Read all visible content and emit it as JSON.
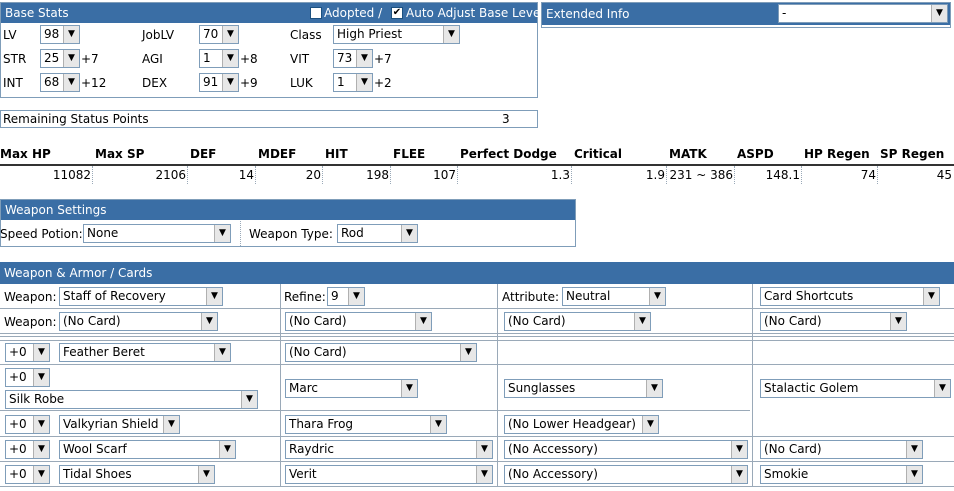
{
  "base_stats": {
    "title": "Base Stats",
    "adopted_label": "Adopted /",
    "adopted_checked": false,
    "auto_adjust_label": "Auto Adjust Base Level",
    "auto_adjust_checked": true,
    "lv_label": "LV",
    "lv": "98",
    "joblv_label": "JobLV",
    "joblv": "70",
    "class_label": "Class",
    "class": "High Priest",
    "str_label": "STR",
    "str": "25",
    "str_bonus": "+7",
    "agi_label": "AGI",
    "agi": "1",
    "agi_bonus": "+8",
    "vit_label": "VIT",
    "vit": "73",
    "vit_bonus": "+7",
    "int_label": "INT",
    "int": "68",
    "int_bonus": "+12",
    "dex_label": "DEX",
    "dex": "91",
    "dex_bonus": "+9",
    "luk_label": "LUK",
    "luk": "1",
    "luk_bonus": "+2"
  },
  "extended_info": {
    "title": "Extended Info",
    "value": "-"
  },
  "remaining": {
    "label": "Remaining Status Points",
    "value": "3"
  },
  "stats_table": {
    "headers": [
      "Max HP",
      "Max SP",
      "DEF",
      "MDEF",
      "HIT",
      "FLEE",
      "Perfect Dodge",
      "Critical",
      "MATK",
      "ASPD",
      "HP Regen",
      "SP Regen"
    ],
    "values": [
      "11082",
      "2106",
      "14",
      "20",
      "198",
      "107",
      "1.3",
      "1.9",
      "231 ~ 386",
      "148.1",
      "74",
      "45"
    ]
  },
  "weapon_settings": {
    "title": "Weapon Settings",
    "speed_potion_label": "Speed Potion:",
    "speed_potion": "None",
    "weapon_type_label": "Weapon Type:",
    "weapon_type": "Rod"
  },
  "equipment": {
    "title": "Weapon & Armor / Cards",
    "weapon_label": "Weapon:",
    "weapon": "Staff of Recovery",
    "refine_label": "Refine:",
    "refine": "9",
    "attribute_label": "Attribute:",
    "attribute": "Neutral",
    "card_shortcuts": "Card Shortcuts",
    "weapon_card_label": "Weapon:",
    "weapon_cards": [
      "(No Card)",
      "(No Card)",
      "(No Card)",
      "(No Card)"
    ],
    "headgear_refine": "+0",
    "headgear": "Feather Beret",
    "headgear_card": "(No Card)",
    "armor_refine": "+0",
    "armor": "Silk Robe",
    "armor_card": "Marc",
    "mid_headgear": "Sunglasses",
    "lower_headgear": "(No Lower Headgear)",
    "upper_card": "Stalactic Golem",
    "shield_refine": "+0",
    "shield": "Valkyrian Shield",
    "shield_card": "Thara Frog",
    "garment_refine": "+0",
    "garment": "Wool Scarf",
    "garment_card": "Raydric",
    "accessory1": "(No Accessory)",
    "accessory1_card": "(No Card)",
    "shoes_refine": "+0",
    "shoes": "Tidal Shoes",
    "shoes_card": "Verit",
    "accessory2": "(No Accessory)",
    "accessory2_card": "Smokie"
  }
}
